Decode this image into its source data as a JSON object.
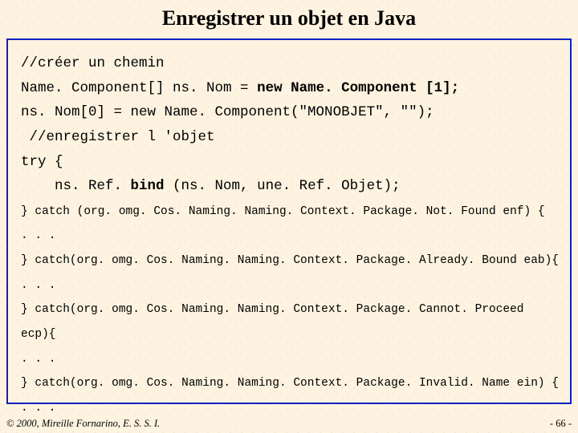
{
  "title": "Enregistrer un objet en Java",
  "code": {
    "l1": "//créer un chemin",
    "l2a": "Name. Component[] ns. Nom = ",
    "l2b": "new Name. Component [1];",
    "l3": "ns. Nom[0] = new Name. Component(\"MONOBJET\", \"\");",
    "l4": " //enregistrer l 'objet",
    "l5": "try {",
    "l6a": "    ns. Ref. ",
    "l6b": "bind",
    "l6c": " (ns. Nom, une. Ref. Objet);",
    "l7": "} catch (org. omg. Cos. Naming. Naming. Context. Package. Not. Found enf) {",
    "l8": ". . .",
    "l9": "} catch(org. omg. Cos. Naming. Naming. Context. Package. Already. Bound eab){",
    "l10": ". . .",
    "l11": "} catch(org. omg. Cos. Naming. Naming. Context. Package. Cannot. Proceed",
    "l12": "ecp){",
    "l13": ". . .",
    "l14": "} catch(org. omg. Cos. Naming. Naming. Context. Package. Invalid. Name ein) {",
    "l15": ". . ."
  },
  "footer": {
    "copyright": "© 2000, Mireille Fornarino, E. S. S. I.",
    "page": "- 66 -"
  }
}
